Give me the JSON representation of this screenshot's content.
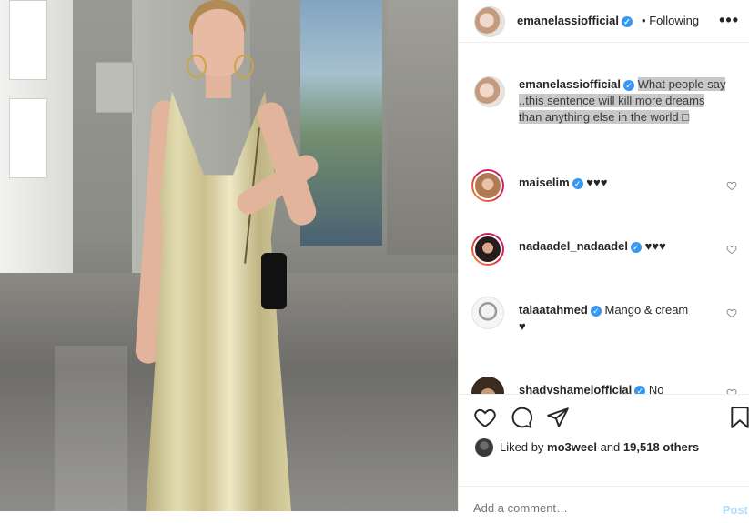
{
  "post": {
    "author": "emanelassiofficial",
    "follow_separator": "•",
    "follow_status": "Following",
    "more_icon": "•••",
    "caption_line1": "What people say",
    "caption_line2": "..this sentence will kill more dreams",
    "caption_line3": "than anything else in the world □"
  },
  "comments": [
    {
      "user": "maiselim",
      "text": "♥♥♥",
      "story_ring": true
    },
    {
      "user": "nadaadel_nadaadel",
      "text": "♥♥♥",
      "story_ring": true
    },
    {
      "user": "talaatahmed",
      "text": "Mango & cream",
      "text2": "♥",
      "story_ring": false
    },
    {
      "user": "shadyshamelofficial",
      "text": "No",
      "story_ring": false
    }
  ],
  "likes": {
    "prefix": "Liked by",
    "user": "mo3weel",
    "middle": "and",
    "count": "19,518",
    "suffix": "others"
  },
  "add_comment": {
    "placeholder": "Add a comment…",
    "post_label": "Post"
  },
  "colors": {
    "verified": "#3897f0",
    "post_button_disabled": "#b2dffc"
  },
  "icons": [
    "heart-icon",
    "comment-icon",
    "share-icon",
    "bookmark-icon",
    "verified-badge-icon",
    "more-options-icon"
  ]
}
